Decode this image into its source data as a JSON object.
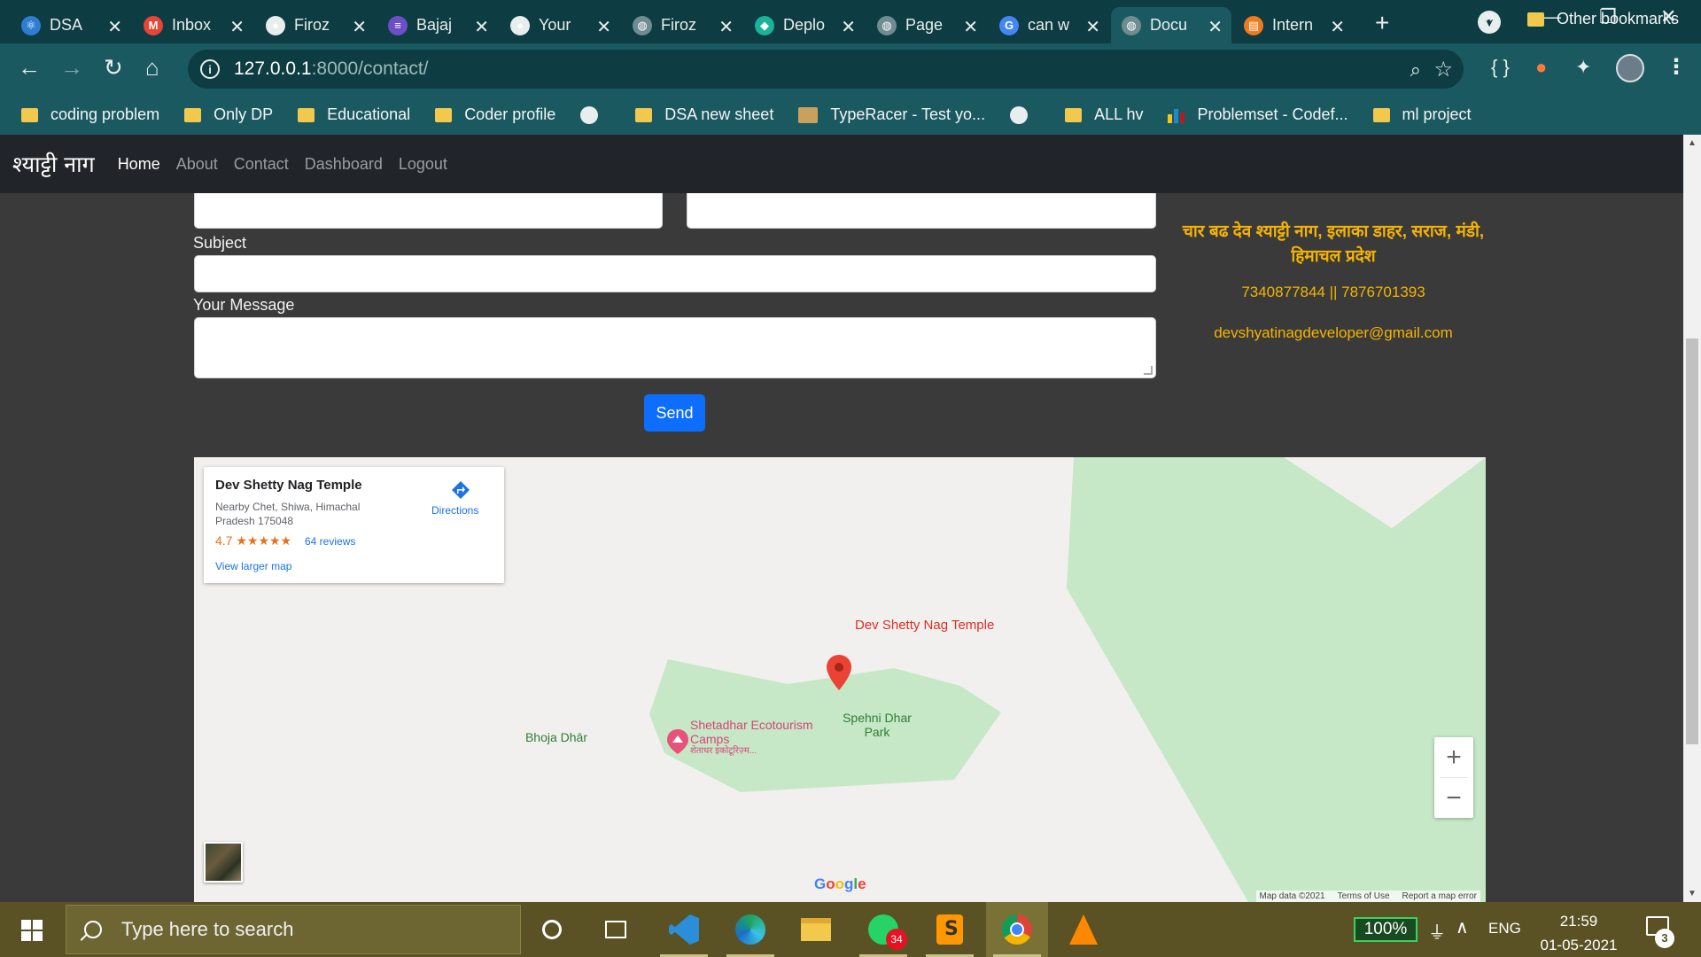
{
  "browser": {
    "tabs": [
      {
        "title": "DSA",
        "fav_color": "#2d7dd2",
        "fav_glyph": "⚛"
      },
      {
        "title": "Inbox",
        "fav_color": "#ea4335",
        "fav_glyph": "M"
      },
      {
        "title": "Firoz",
        "fav_color": "#e8eded",
        "fav_glyph": "●"
      },
      {
        "title": "Bajaj",
        "fav_color": "#6c4fc7",
        "fav_glyph": "≡"
      },
      {
        "title": "Your",
        "fav_color": "#e8eded",
        "fav_glyph": "●"
      },
      {
        "title": "Firoz",
        "fav_color": "#6f8c90",
        "fav_glyph": "◍"
      },
      {
        "title": "Deplo",
        "fav_color": "#19b39a",
        "fav_glyph": "◆"
      },
      {
        "title": "Page",
        "fav_color": "#6f8c90",
        "fav_glyph": "◍"
      },
      {
        "title": "can w",
        "fav_color": "#4285f4",
        "fav_glyph": "G"
      },
      {
        "title": "Docu",
        "fav_color": "#6f8c90",
        "fav_glyph": "◍",
        "active": true
      },
      {
        "title": "Intern",
        "fav_color": "#f07b1d",
        "fav_glyph": "▤"
      }
    ],
    "url_host": "127.0.0.1",
    "url_path": ":8000/contact/",
    "bookmarks": [
      {
        "label": "coding problem",
        "icon": "folder"
      },
      {
        "label": "Only DP",
        "icon": "folder"
      },
      {
        "label": "Educational",
        "icon": "folder"
      },
      {
        "label": "Coder profile",
        "icon": "folder"
      },
      {
        "label": "",
        "icon": "globe"
      },
      {
        "label": "DSA new sheet",
        "icon": "folder"
      },
      {
        "label": "TypeRacer - Test yo...",
        "icon": "racer"
      },
      {
        "label": "",
        "icon": "globe"
      },
      {
        "label": "ALL hv",
        "icon": "folder"
      },
      {
        "label": "Problemset - Codef...",
        "icon": "bars"
      },
      {
        "label": "ml project",
        "icon": "folder"
      }
    ],
    "bookmarks_more": "»",
    "other_bookmarks": "Other bookmarks"
  },
  "site": {
    "brand": "श्याट्टी नाग",
    "nav": [
      {
        "label": "Home",
        "active": true
      },
      {
        "label": "About"
      },
      {
        "label": "Contact"
      },
      {
        "label": "Dashboard"
      },
      {
        "label": "Logout"
      }
    ]
  },
  "form": {
    "subject_label": "Subject",
    "message_label": "Your Message",
    "send_label": "Send"
  },
  "contact": {
    "address": "चार बढ देव श्याट्टी नाग, इलाका डाहर, सराज, मंडी, हिमाचल प्रदेश",
    "phones": "7340877844 || 7876701393",
    "email": "devshyatinagdeveloper@gmail.com"
  },
  "map": {
    "place_name": "Dev Shetty Nag Temple",
    "address": "Nearby Chet, Shiwa, Himachal Pradesh 175048",
    "rating": "4.7 ★★★★★",
    "reviews": "64 reviews",
    "larger_map": "View larger map",
    "directions": "Directions",
    "pin_label": "Dev Shetty Nag Temple",
    "park_label": "Spehni Dhar Park",
    "camp_label": "Shetadhar Ecotourism Camps",
    "camp_sub": "शेताधर इकोटूरिज़्म...",
    "village_label": "Bhoja Dhār",
    "zoom_in": "+",
    "zoom_out": "−",
    "map_data": "Map data ©2021",
    "terms": "Terms of Use",
    "report": "Report a map error"
  },
  "taskbar": {
    "search_placeholder": "Type here to search",
    "whatsapp_badge": "34",
    "battery": "100%",
    "language": "ENG",
    "time": "21:59",
    "date": "01-05-2021",
    "notifications": "3"
  }
}
